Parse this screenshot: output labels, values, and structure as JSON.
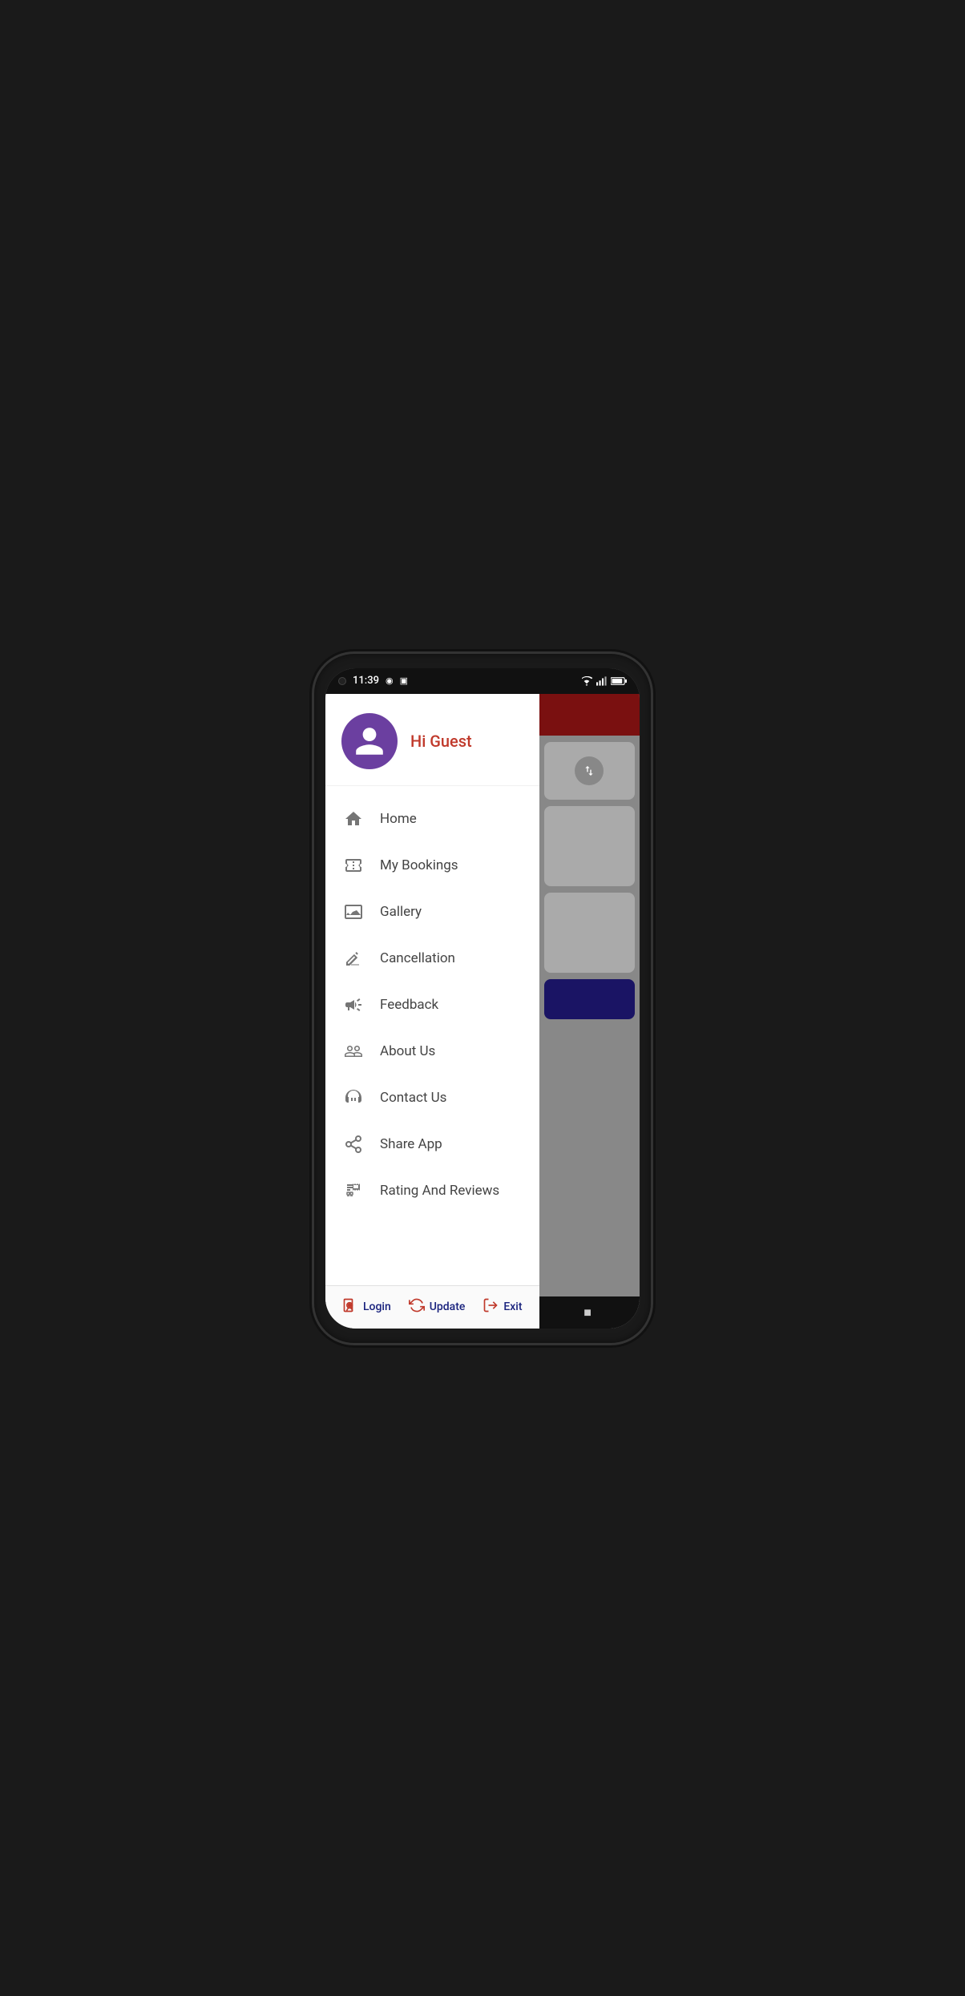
{
  "statusBar": {
    "time": "11:39",
    "wifi": true,
    "signal": true,
    "battery": true
  },
  "drawer": {
    "greeting": "Hi Guest",
    "navItems": [
      {
        "id": "home",
        "label": "Home",
        "icon": "home"
      },
      {
        "id": "my-bookings",
        "label": "My Bookings",
        "icon": "ticket"
      },
      {
        "id": "gallery",
        "label": "Gallery",
        "icon": "gallery"
      },
      {
        "id": "cancellation",
        "label": "Cancellation",
        "icon": "scissors"
      },
      {
        "id": "feedback",
        "label": "Feedback",
        "icon": "megaphone"
      },
      {
        "id": "about-us",
        "label": "About Us",
        "icon": "about"
      },
      {
        "id": "contact-us",
        "label": "Contact Us",
        "icon": "headset"
      },
      {
        "id": "share-app",
        "label": "Share App",
        "icon": "share"
      },
      {
        "id": "rating-reviews",
        "label": "Rating And Reviews",
        "icon": "rating"
      }
    ],
    "footer": {
      "loginLabel": "Login",
      "updateLabel": "Update",
      "exitLabel": "Exit"
    }
  },
  "navBar": {
    "backLabel": "◀",
    "homeLabel": "●",
    "recentLabel": "■"
  }
}
